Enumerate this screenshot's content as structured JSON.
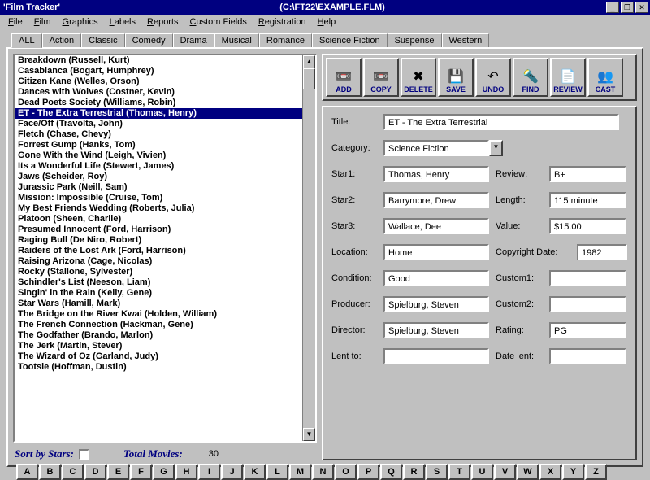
{
  "window": {
    "title": "'Film Tracker'",
    "path": "(C:\\FT22\\EXAMPLE.FLM)"
  },
  "menu": [
    "File",
    "Film",
    "Graphics",
    "Labels",
    "Reports",
    "Custom Fields",
    "Registration",
    "Help"
  ],
  "tabs": [
    "ALL",
    "Action",
    "Classic",
    "Comedy",
    "Drama",
    "Musical",
    "Romance",
    "Science Fiction",
    "Suspense",
    "Western"
  ],
  "films": [
    "Breakdown (Russell, Kurt)",
    "Casablanca (Bogart, Humphrey)",
    "Citizen Kane (Welles, Orson)",
    "Dances with Wolves (Costner, Kevin)",
    "Dead Poets Society (Williams, Robin)",
    "ET - The Extra Terrestrial (Thomas, Henry)",
    "Face/Off (Travolta, John)",
    "Fletch (Chase, Chevy)",
    "Forrest Gump (Hanks, Tom)",
    "Gone With the Wind (Leigh, Vivien)",
    "Its a Wonderful Life (Stewert, James)",
    "Jaws (Scheider, Roy)",
    "Jurassic Park (Neill, Sam)",
    "Mission: Impossible (Cruise, Tom)",
    "My Best Friends Wedding (Roberts, Julia)",
    "Platoon (Sheen, Charlie)",
    "Presumed Innocent (Ford, Harrison)",
    "Raging Bull (De Niro, Robert)",
    "Raiders of the Lost Ark (Ford, Harrison)",
    "Raising Arizona (Cage, Nicolas)",
    "Rocky (Stallone, Sylvester)",
    "Schindler's List (Neeson, Liam)",
    "Singin' in the Rain (Kelly, Gene)",
    "Star Wars (Hamill, Mark)",
    "The Bridge on the River Kwai (Holden, William)",
    "The French Connection (Hackman, Gene)",
    "The Godfather (Brando, Marlon)",
    "The Jerk (Martin, Stever)",
    "The Wizard of Oz (Garland, Judy)",
    "Tootsie (Hoffman, Dustin)"
  ],
  "selectedIndex": 5,
  "sortLabel": "Sort by Stars:",
  "totalLabel": "Total Movies:",
  "totalCount": "30",
  "toolbar": [
    {
      "label": "ADD",
      "icon": "📼"
    },
    {
      "label": "COPY",
      "icon": "📼"
    },
    {
      "label": "DELETE",
      "icon": "✖"
    },
    {
      "label": "SAVE",
      "icon": "💾"
    },
    {
      "label": "UNDO",
      "icon": "↶"
    },
    {
      "label": "FIND",
      "icon": "🔦"
    },
    {
      "label": "REVIEW",
      "icon": "📄"
    },
    {
      "label": "CAST",
      "icon": "👥"
    }
  ],
  "labels": {
    "title": "Title:",
    "category": "Category:",
    "star1": "Star1:",
    "star2": "Star2:",
    "star3": "Star3:",
    "location": "Location:",
    "condition": "Condition:",
    "producer": "Producer:",
    "director": "Director:",
    "lentto": "Lent to:",
    "review": "Review:",
    "length": "Length:",
    "value": "Value:",
    "copyright": "Copyright Date:",
    "custom1": "Custom1:",
    "custom2": "Custom2:",
    "rating": "Rating:",
    "datelent": "Date lent:"
  },
  "detail": {
    "title": "ET - The Extra Terrestrial",
    "category": "Science Fiction",
    "star1": "Thomas, Henry",
    "star2": "Barrymore, Drew",
    "star3": "Wallace, Dee",
    "location": "Home",
    "condition": "Good",
    "producer": "Spielburg, Steven",
    "director": "Spielburg, Steven",
    "lentto": "",
    "review": "B+",
    "length": "115 minute",
    "value": "$15.00",
    "copyright": "1982",
    "custom1": "",
    "custom2": "",
    "rating": "PG",
    "datelent": ""
  },
  "alpha": [
    "A",
    "B",
    "C",
    "D",
    "E",
    "F",
    "G",
    "H",
    "I",
    "J",
    "K",
    "L",
    "M",
    "N",
    "O",
    "P",
    "Q",
    "R",
    "S",
    "T",
    "U",
    "V",
    "W",
    "X",
    "Y",
    "Z"
  ]
}
